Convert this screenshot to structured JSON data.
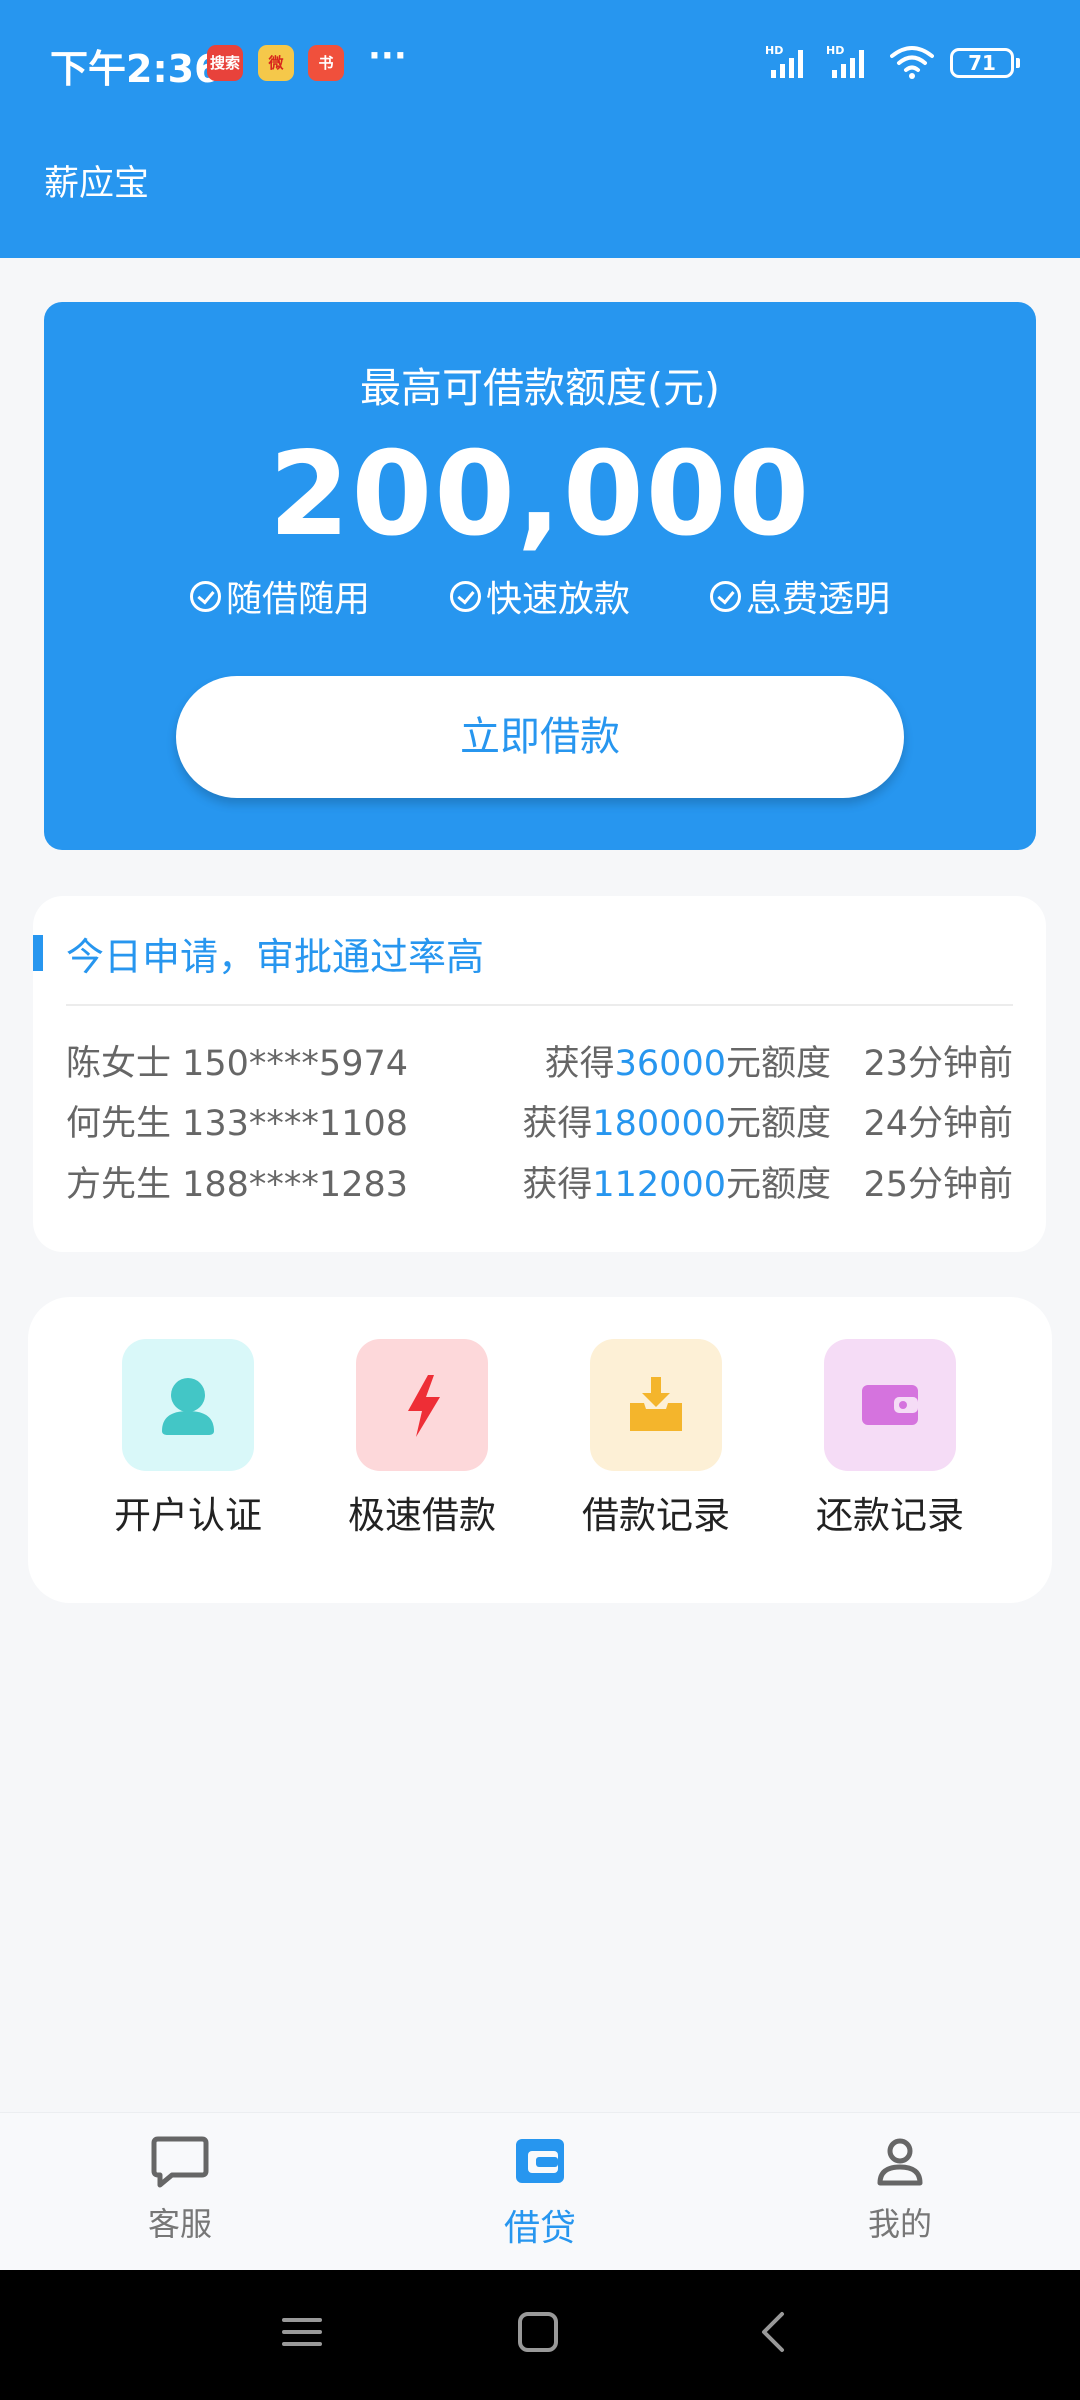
{
  "status_bar": {
    "time": "下午2:36",
    "notifications": [
      "搜索",
      "微",
      "书"
    ],
    "more": "···",
    "battery": "71"
  },
  "app": {
    "title": "薪应宝"
  },
  "hero": {
    "label": "最高可借款额度(元)",
    "amount": "200,000",
    "features": [
      "随借随用",
      "快速放款",
      "息费透明"
    ],
    "button": "立即借款"
  },
  "applications": {
    "title": "今日申请，审批通过率高",
    "rows": [
      {
        "user": "陈女士 150****5974",
        "prefix": "获得",
        "amount": "36000",
        "suffix": "元额度",
        "ago": "23分钟前"
      },
      {
        "user": "何先生 133****1108",
        "prefix": "获得",
        "amount": "180000",
        "suffix": "元额度",
        "ago": "24分钟前"
      },
      {
        "user": "方先生 188****1283",
        "prefix": "获得",
        "amount": "112000",
        "suffix": "元额度",
        "ago": "25分钟前"
      }
    ]
  },
  "menu": {
    "items": [
      {
        "label": "开户认证",
        "icon": "user-icon",
        "color": "#43c6c6"
      },
      {
        "label": "极速借款",
        "icon": "lightning-icon",
        "color": "#ee2e36"
      },
      {
        "label": "借款记录",
        "icon": "download-tray-icon",
        "color": "#f4b52c"
      },
      {
        "label": "还款记录",
        "icon": "wallet-icon",
        "color": "#d573de"
      }
    ]
  },
  "tabbar": {
    "tabs": [
      {
        "label": "客服",
        "icon": "chat-bubble-icon"
      },
      {
        "label": "借贷",
        "icon": "wallet-icon"
      },
      {
        "label": "我的",
        "icon": "profile-icon"
      }
    ],
    "active": "借贷"
  },
  "colors": {
    "primary": "#2796ef",
    "background": "#f6f7f9"
  }
}
